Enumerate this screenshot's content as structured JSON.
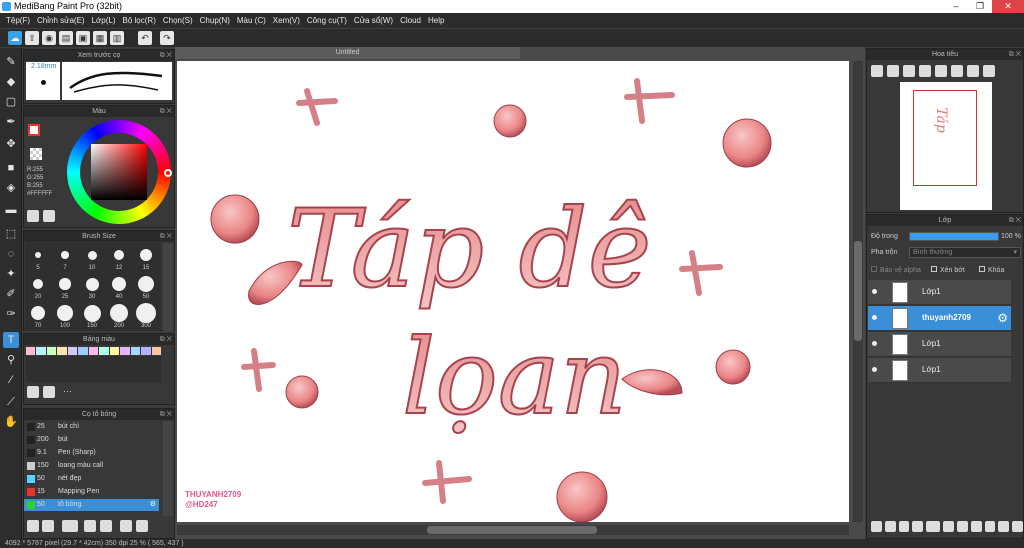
{
  "app": {
    "title": "MediBang Paint Pro (32bit)",
    "window_controls": [
      "–",
      "❐",
      "✕"
    ]
  },
  "menu": [
    "Tệp(F)",
    "Chỉnh sửa(E)",
    "Lớp(L)",
    "Bộ lọc(R)",
    "Chọn(S)",
    "Chụp(N)",
    "Màu (C)",
    "Xem(V)",
    "Công cụ(T)",
    "Cửa sổ(W)",
    "Cloud",
    "Help"
  ],
  "panels": {
    "brush_preview": {
      "title": "Xem trước cọ",
      "size": "2.18mm"
    },
    "color": {
      "title": "Màu",
      "r": "R:255",
      "g": "G:255",
      "b": "B:255",
      "hex": "#FFFFFF"
    },
    "brush_size": {
      "title": "Brush Size",
      "rows": [
        [
          "5",
          "7",
          "10",
          "12",
          "15"
        ],
        [
          "20",
          "25",
          "30",
          "40",
          "50"
        ],
        [
          "70",
          "100",
          "150",
          "200",
          "300"
        ]
      ]
    },
    "palette": {
      "title": "Bảng màu"
    },
    "brush": {
      "title": "Cọ tô bóng",
      "items": [
        {
          "size": "25",
          "name": "bút chì",
          "color": "#222222"
        },
        {
          "size": "200",
          "name": "bút",
          "color": "#222222"
        },
        {
          "size": "9.1",
          "name": "Pen (Sharp)",
          "color": "#222222"
        },
        {
          "size": "150",
          "name": "loang màu call",
          "color": "#cccccc"
        },
        {
          "size": "50",
          "name": "nét đẹp",
          "color": "#5ad2ff"
        },
        {
          "size": "15",
          "name": "Mapping Pen",
          "color": "#e8332b"
        },
        {
          "size": "50",
          "name": "tô bóng",
          "color": "#2fd12f"
        }
      ]
    }
  },
  "canvas": {
    "tab": "Untitled",
    "art_text_1": "Táp dê",
    "art_text_2": "lọan",
    "signature_1": "THUYANH2709",
    "signature_2": "@HD247"
  },
  "navigator": {
    "title": "Hoa tiêu"
  },
  "layers": {
    "title": "Lớp",
    "opacity_label": "Độ trong",
    "opacity_value": "100 %",
    "opacity": 1.0,
    "blend_label": "Pha trộn",
    "blend_value": "Bình thường",
    "protect_alpha": "Bảo vệ alpha",
    "clip": "Xén bớt",
    "lock": "Khóa",
    "items": [
      {
        "name": "Lớp1",
        "selected": false
      },
      {
        "name": "thuyanh2709",
        "selected": true
      },
      {
        "name": "Lớp1",
        "selected": false
      },
      {
        "name": "Lớp1",
        "selected": false
      }
    ]
  },
  "status": "4092 * 5787 pixel  (29.7 * 42cm)  350 dpi  25 %  ( 565, 437 )"
}
